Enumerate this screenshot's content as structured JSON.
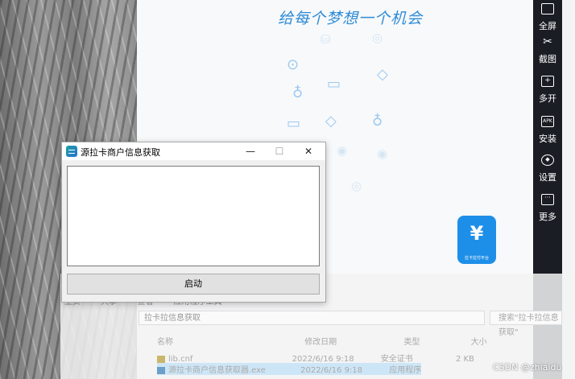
{
  "app": {
    "slogan": "给每个梦想一个机会",
    "brand_tile": {
      "symbol": "¥",
      "caption": "拉卡拉付平台"
    }
  },
  "toolbar": {
    "items": [
      {
        "label": "全屏",
        "icon": "fullscreen-icon",
        "glyph": ""
      },
      {
        "label": "截图",
        "icon": "scissors-icon",
        "glyph": "✂"
      },
      {
        "label": "多开",
        "icon": "multi-open-icon",
        "glyph": "+"
      },
      {
        "label": "安装",
        "icon": "apk-install-icon",
        "glyph": "APK"
      },
      {
        "label": "设置",
        "icon": "settings-icon",
        "glyph": "◆"
      },
      {
        "label": "更多",
        "icon": "more-icon",
        "glyph": "···"
      }
    ]
  },
  "dialog": {
    "title": "源拉卡商户信息获取",
    "minimize": "—",
    "maximize": "☐",
    "close": "✕",
    "log_text": "",
    "start_label": "启动"
  },
  "explorer": {
    "tabs": [
      "主页",
      "共享",
      "查看",
      "应用程序工具"
    ],
    "address": "拉卡拉信息获取",
    "search_placeholder": "搜索\"拉卡拉信息获取\"",
    "headers": [
      "名称",
      "修改日期",
      "类型",
      "大小"
    ],
    "rows": [
      {
        "name": "lib.cnf",
        "date": "2022/6/16 9:18",
        "type": "安全证书",
        "size": "2 KB"
      },
      {
        "name": "源拉卡商户信息获取器.exe",
        "date": "2022/6/16 9:18",
        "type": "应用程序",
        "size": ""
      }
    ]
  },
  "watermark": "CSDN @zhiaidu"
}
